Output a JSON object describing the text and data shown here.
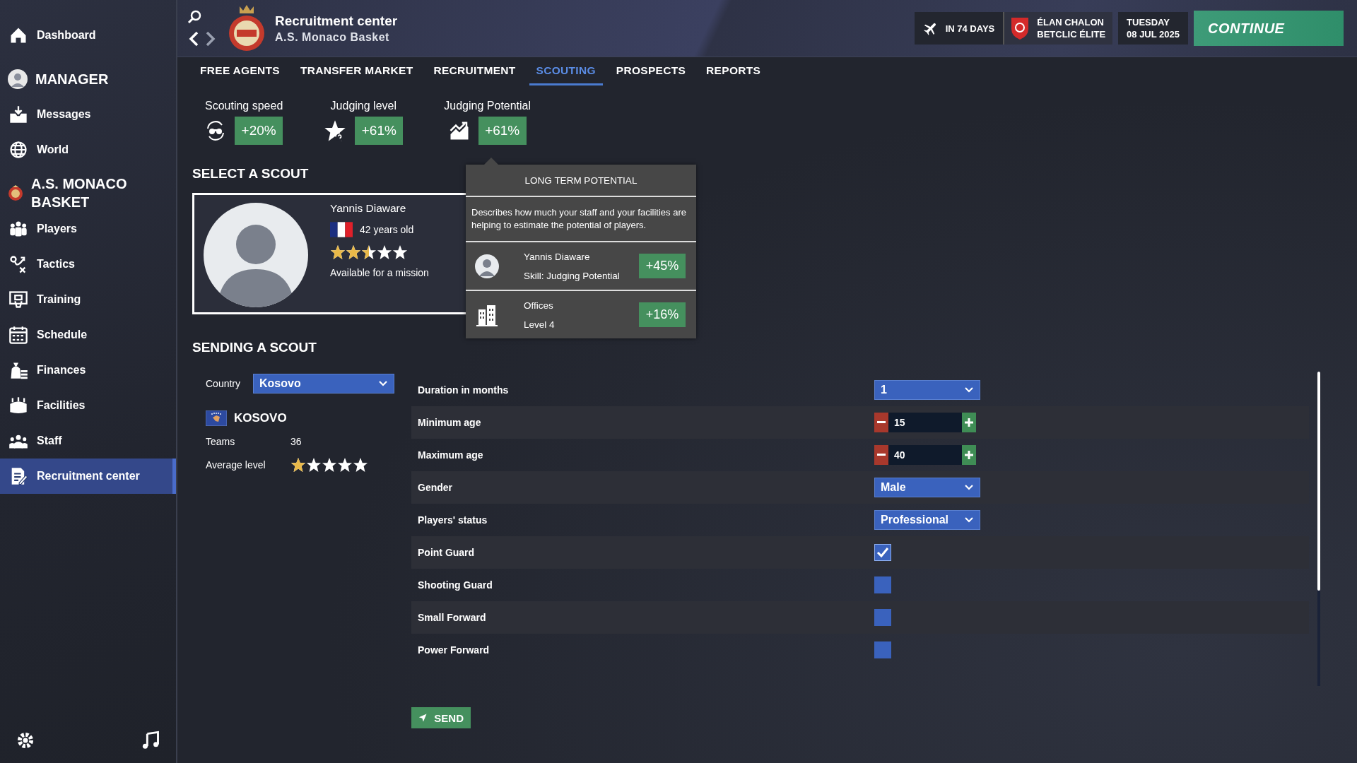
{
  "sidebar": {
    "items": [
      {
        "kind": "link",
        "label": "Dashboard",
        "selected": false
      },
      {
        "kind": "section",
        "label": "MANAGER"
      },
      {
        "kind": "link",
        "label": "Messages",
        "selected": false
      },
      {
        "kind": "link",
        "label": "World",
        "selected": false
      },
      {
        "kind": "section",
        "label": "A.S. MONACO BASKET"
      },
      {
        "kind": "link",
        "label": "Players",
        "selected": false
      },
      {
        "kind": "link",
        "label": "Tactics",
        "selected": false
      },
      {
        "kind": "link",
        "label": "Training",
        "selected": false
      },
      {
        "kind": "link",
        "label": "Schedule",
        "selected": false
      },
      {
        "kind": "link",
        "label": "Finances",
        "selected": false
      },
      {
        "kind": "link",
        "label": "Facilities",
        "selected": false
      },
      {
        "kind": "link",
        "label": "Staff",
        "selected": false
      },
      {
        "kind": "link",
        "label": "Recruitment center",
        "selected": true
      }
    ]
  },
  "header": {
    "title": "Recruitment center",
    "subtitle": "A.S. Monaco Basket",
    "next_match": {
      "countdown": "IN 74 DAYS",
      "opponent": "ÉLAN CHALON",
      "competition": "BETCLIC ÉLITE"
    },
    "date": {
      "weekday": "TUESDAY",
      "day": "08 JUL 2025"
    },
    "continue_button": "CONTINUE"
  },
  "tabs": [
    {
      "label": "FREE AGENTS",
      "selected": false
    },
    {
      "label": "TRANSFER MARKET",
      "selected": false
    },
    {
      "label": "RECRUITMENT",
      "selected": false
    },
    {
      "label": "SCOUTING",
      "selected": true
    },
    {
      "label": "PROSPECTS",
      "selected": false
    },
    {
      "label": "REPORTS",
      "selected": false
    }
  ],
  "stats": [
    {
      "label": "Scouting speed",
      "value": "+20%"
    },
    {
      "label": "Judging level",
      "value": "+61%"
    },
    {
      "label": "Judging Potential",
      "value": "+61%"
    }
  ],
  "select_scout": {
    "heading": "SELECT A SCOUT",
    "scout": {
      "name": "Yannis Diaware",
      "age": "42 years old",
      "stars": 2.5,
      "status": "Available for a mission"
    }
  },
  "tooltip": {
    "title": "LONG TERM POTENTIAL",
    "description": "Describes how much your staff and your facilities are helping to estimate the potential of players.",
    "contributions": [
      {
        "name": "Yannis Diaware",
        "detail": "Skill: Judging Potential",
        "value": "+45%"
      },
      {
        "name": "Offices",
        "detail": "Level 4",
        "value": "+16%"
      }
    ]
  },
  "sending": {
    "heading": "SENDING A SCOUT",
    "country_label": "Country",
    "country_select": "Kosovo",
    "country_name": "KOSOVO",
    "teams_label": "Teams",
    "teams_value": "36",
    "average_label": "Average level",
    "stars": 1,
    "rows": [
      {
        "kind": "select",
        "label": "Duration in months",
        "value": "1"
      },
      {
        "kind": "stepper",
        "label": "Minimum age",
        "value": "15"
      },
      {
        "kind": "stepper",
        "label": "Maximum age",
        "value": "40"
      },
      {
        "kind": "select",
        "label": "Gender",
        "value": "Male"
      },
      {
        "kind": "select",
        "label": "Players' status",
        "value": "Professional"
      },
      {
        "kind": "checkbox",
        "label": "Point Guard",
        "checked": true
      },
      {
        "kind": "checkbox",
        "label": "Shooting Guard",
        "checked": false
      },
      {
        "kind": "checkbox",
        "label": "Small Forward",
        "checked": false
      },
      {
        "kind": "checkbox",
        "label": "Power Forward",
        "checked": false
      }
    ],
    "send_button": "SEND"
  }
}
